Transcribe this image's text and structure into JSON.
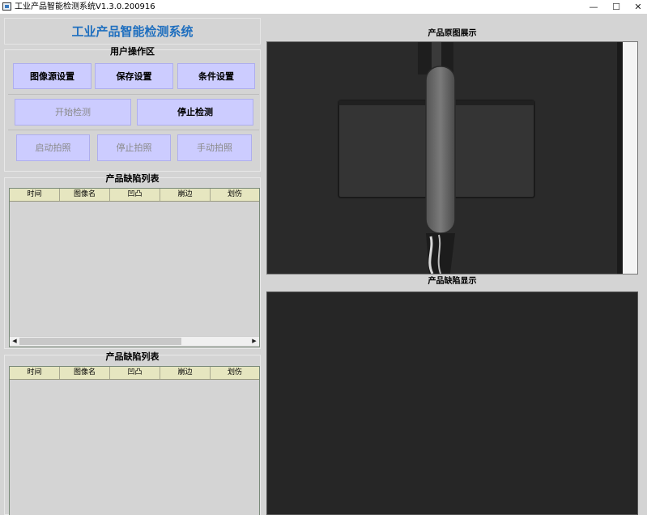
{
  "window": {
    "title": "工业产品智能检测系统V1.3.0.200916",
    "minimize_glyph": "—",
    "maximize_glyph": "☐",
    "close_glyph": "✕",
    "icon": "app-window-icon"
  },
  "header": {
    "app_title": "工业产品智能检测系统"
  },
  "operations": {
    "title": "用户操作区",
    "row1": [
      "图像源设置",
      "保存设置",
      "条件设置"
    ],
    "row2": [
      "开始检测",
      "停止检测"
    ],
    "row3": [
      "启动拍照",
      "停止拍照",
      "手动拍照"
    ]
  },
  "defect_table_top": {
    "title": "产品缺陷列表",
    "columns": [
      "时间",
      "图像名",
      "凹凸",
      "崩边",
      "划伤"
    ],
    "scroll_left": "◀",
    "scroll_right": "▶"
  },
  "defect_table_bottom": {
    "title": "产品缺陷列表",
    "columns": [
      "时间",
      "图像名",
      "凹凸",
      "崩边",
      "划伤"
    ]
  },
  "right_panel": {
    "original_title": "产品原图展示",
    "defect_title": "产品缺陷显示"
  },
  "colors": {
    "accent_title": "#1f6fbf",
    "button_bg": "#ccccff",
    "table_header_bg": "#e6e6c0",
    "background": "#d4d4d4"
  }
}
